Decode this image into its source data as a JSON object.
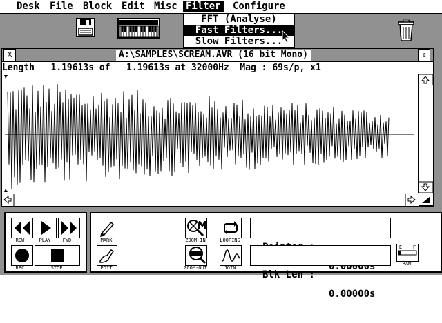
{
  "menu": [
    "Desk",
    "File",
    "Block",
    "Edit",
    "Misc",
    "Filter",
    "Configure"
  ],
  "filter_menu": [
    "FFT (Analyse)",
    "Fast Filters...",
    "Slow Filters..."
  ],
  "window": {
    "title": "A:\\SAMPLES\\SCREAM.AVR (16 bit Mono)",
    "close_glyph": "X",
    "fuller_glyph": "⇕",
    "info": "Length   1.19613s of   1.19613s at 32000Hz  Mag : 69s/p, x1"
  },
  "transport": {
    "rew": "REW.",
    "play": "PLAY",
    "fwd": "FWD.",
    "rec": "REC.",
    "stop": "STOP"
  },
  "tools": {
    "mark": "MARK",
    "edit": "EDIT",
    "zoom_in": "ZOOM-IN",
    "zoom_out": "ZOOM-OUT",
    "looping": "LOOPING",
    "join": "JOIN",
    "ram": "RAM",
    "ram_e": "E",
    "ram_f": "F"
  },
  "pointer": {
    "label": "Pointer :",
    "value": "0.00000s"
  },
  "blklen": {
    "label": "Blk Len :",
    "value": "0.00000s"
  }
}
